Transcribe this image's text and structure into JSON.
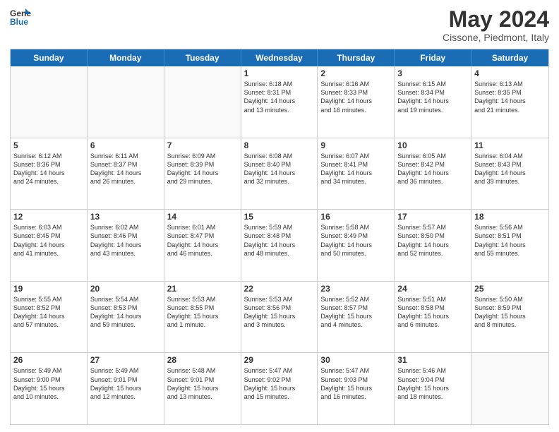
{
  "logo": {
    "line1": "General",
    "line2": "Blue"
  },
  "title": "May 2024",
  "subtitle": "Cissone, Piedmont, Italy",
  "days": [
    "Sunday",
    "Monday",
    "Tuesday",
    "Wednesday",
    "Thursday",
    "Friday",
    "Saturday"
  ],
  "rows": [
    [
      {
        "num": "",
        "text": "",
        "empty": true
      },
      {
        "num": "",
        "text": "",
        "empty": true
      },
      {
        "num": "",
        "text": "",
        "empty": true
      },
      {
        "num": "1",
        "text": "Sunrise: 6:18 AM\nSunset: 8:31 PM\nDaylight: 14 hours\nand 13 minutes."
      },
      {
        "num": "2",
        "text": "Sunrise: 6:16 AM\nSunset: 8:33 PM\nDaylight: 14 hours\nand 16 minutes."
      },
      {
        "num": "3",
        "text": "Sunrise: 6:15 AM\nSunset: 8:34 PM\nDaylight: 14 hours\nand 19 minutes."
      },
      {
        "num": "4",
        "text": "Sunrise: 6:13 AM\nSunset: 8:35 PM\nDaylight: 14 hours\nand 21 minutes."
      }
    ],
    [
      {
        "num": "5",
        "text": "Sunrise: 6:12 AM\nSunset: 8:36 PM\nDaylight: 14 hours\nand 24 minutes."
      },
      {
        "num": "6",
        "text": "Sunrise: 6:11 AM\nSunset: 8:37 PM\nDaylight: 14 hours\nand 26 minutes."
      },
      {
        "num": "7",
        "text": "Sunrise: 6:09 AM\nSunset: 8:39 PM\nDaylight: 14 hours\nand 29 minutes."
      },
      {
        "num": "8",
        "text": "Sunrise: 6:08 AM\nSunset: 8:40 PM\nDaylight: 14 hours\nand 32 minutes."
      },
      {
        "num": "9",
        "text": "Sunrise: 6:07 AM\nSunset: 8:41 PM\nDaylight: 14 hours\nand 34 minutes."
      },
      {
        "num": "10",
        "text": "Sunrise: 6:05 AM\nSunset: 8:42 PM\nDaylight: 14 hours\nand 36 minutes."
      },
      {
        "num": "11",
        "text": "Sunrise: 6:04 AM\nSunset: 8:43 PM\nDaylight: 14 hours\nand 39 minutes."
      }
    ],
    [
      {
        "num": "12",
        "text": "Sunrise: 6:03 AM\nSunset: 8:45 PM\nDaylight: 14 hours\nand 41 minutes."
      },
      {
        "num": "13",
        "text": "Sunrise: 6:02 AM\nSunset: 8:46 PM\nDaylight: 14 hours\nand 43 minutes."
      },
      {
        "num": "14",
        "text": "Sunrise: 6:01 AM\nSunset: 8:47 PM\nDaylight: 14 hours\nand 46 minutes."
      },
      {
        "num": "15",
        "text": "Sunrise: 5:59 AM\nSunset: 8:48 PM\nDaylight: 14 hours\nand 48 minutes."
      },
      {
        "num": "16",
        "text": "Sunrise: 5:58 AM\nSunset: 8:49 PM\nDaylight: 14 hours\nand 50 minutes."
      },
      {
        "num": "17",
        "text": "Sunrise: 5:57 AM\nSunset: 8:50 PM\nDaylight: 14 hours\nand 52 minutes."
      },
      {
        "num": "18",
        "text": "Sunrise: 5:56 AM\nSunset: 8:51 PM\nDaylight: 14 hours\nand 55 minutes."
      }
    ],
    [
      {
        "num": "19",
        "text": "Sunrise: 5:55 AM\nSunset: 8:52 PM\nDaylight: 14 hours\nand 57 minutes."
      },
      {
        "num": "20",
        "text": "Sunrise: 5:54 AM\nSunset: 8:53 PM\nDaylight: 14 hours\nand 59 minutes."
      },
      {
        "num": "21",
        "text": "Sunrise: 5:53 AM\nSunset: 8:55 PM\nDaylight: 15 hours\nand 1 minute."
      },
      {
        "num": "22",
        "text": "Sunrise: 5:53 AM\nSunset: 8:56 PM\nDaylight: 15 hours\nand 3 minutes."
      },
      {
        "num": "23",
        "text": "Sunrise: 5:52 AM\nSunset: 8:57 PM\nDaylight: 15 hours\nand 4 minutes."
      },
      {
        "num": "24",
        "text": "Sunrise: 5:51 AM\nSunset: 8:58 PM\nDaylight: 15 hours\nand 6 minutes."
      },
      {
        "num": "25",
        "text": "Sunrise: 5:50 AM\nSunset: 8:59 PM\nDaylight: 15 hours\nand 8 minutes."
      }
    ],
    [
      {
        "num": "26",
        "text": "Sunrise: 5:49 AM\nSunset: 9:00 PM\nDaylight: 15 hours\nand 10 minutes."
      },
      {
        "num": "27",
        "text": "Sunrise: 5:49 AM\nSunset: 9:01 PM\nDaylight: 15 hours\nand 12 minutes."
      },
      {
        "num": "28",
        "text": "Sunrise: 5:48 AM\nSunset: 9:01 PM\nDaylight: 15 hours\nand 13 minutes."
      },
      {
        "num": "29",
        "text": "Sunrise: 5:47 AM\nSunset: 9:02 PM\nDaylight: 15 hours\nand 15 minutes."
      },
      {
        "num": "30",
        "text": "Sunrise: 5:47 AM\nSunset: 9:03 PM\nDaylight: 15 hours\nand 16 minutes."
      },
      {
        "num": "31",
        "text": "Sunrise: 5:46 AM\nSunset: 9:04 PM\nDaylight: 15 hours\nand 18 minutes."
      },
      {
        "num": "",
        "text": "",
        "empty": true
      }
    ]
  ]
}
